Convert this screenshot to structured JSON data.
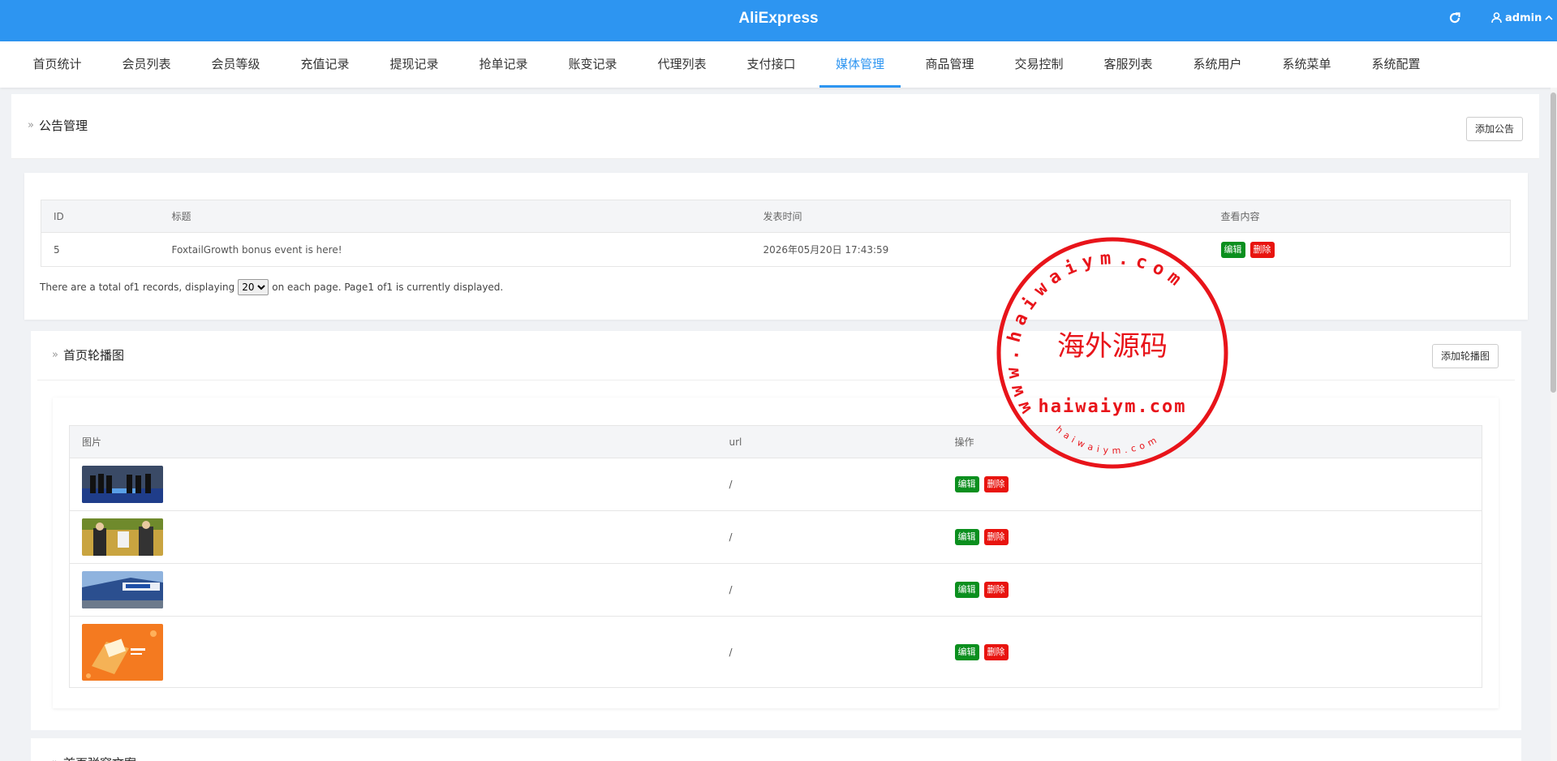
{
  "topbar": {
    "title": "AliExpress",
    "user": "admin",
    "refresh_icon": "refresh-icon",
    "user_icon": "user-icon",
    "bg_color": "#2d95f1"
  },
  "nav": {
    "items": [
      {
        "label": "首页统计"
      },
      {
        "label": "会员列表"
      },
      {
        "label": "会员等级"
      },
      {
        "label": "充值记录"
      },
      {
        "label": "提现记录"
      },
      {
        "label": "抢单记录"
      },
      {
        "label": "账变记录"
      },
      {
        "label": "代理列表"
      },
      {
        "label": "支付接口"
      },
      {
        "label": "媒体管理",
        "active": true
      },
      {
        "label": "商品管理"
      },
      {
        "label": "交易控制"
      },
      {
        "label": "客服列表"
      },
      {
        "label": "系统用户"
      },
      {
        "label": "系统菜单"
      },
      {
        "label": "系统配置"
      }
    ],
    "active_color": "#2d95f1"
  },
  "announcements": {
    "title": "公告管理",
    "add_button": "添加公告",
    "columns": [
      "ID",
      "标题",
      "发表时间",
      "查看内容"
    ],
    "rows": [
      {
        "id": "5",
        "title": "FoxtailGrowth bonus event is here!",
        "time": "2026年05月20日 17:43:59",
        "edit": "编辑",
        "delete": "删除"
      }
    ],
    "pager": {
      "prefix": "There are a total of1 records, displaying",
      "page_size": "20",
      "suffix": "on each page. Page1 of1 is currently displayed."
    }
  },
  "carousel": {
    "title": "首页轮播图",
    "add_button": "添加轮播图",
    "columns": [
      "图片",
      "url",
      "操作"
    ],
    "rows": [
      {
        "url": "/",
        "edit": "编辑",
        "delete": "删除"
      },
      {
        "url": "/",
        "edit": "编辑",
        "delete": "删除"
      },
      {
        "url": "/",
        "edit": "编辑",
        "delete": "删除"
      },
      {
        "url": "/",
        "edit": "编辑",
        "delete": "删除"
      }
    ]
  },
  "next_section": {
    "title": "首页弹窗文案"
  },
  "watermark": {
    "ring_text": "www.haiwaiym.com",
    "center_text": "海外源码",
    "domain_text": "haiwaiym.com",
    "bottom_text": "haiwaiym.com",
    "color": "#e8141a"
  },
  "colors": {
    "edit": "#0b8f1e",
    "delete": "#e8140f"
  }
}
